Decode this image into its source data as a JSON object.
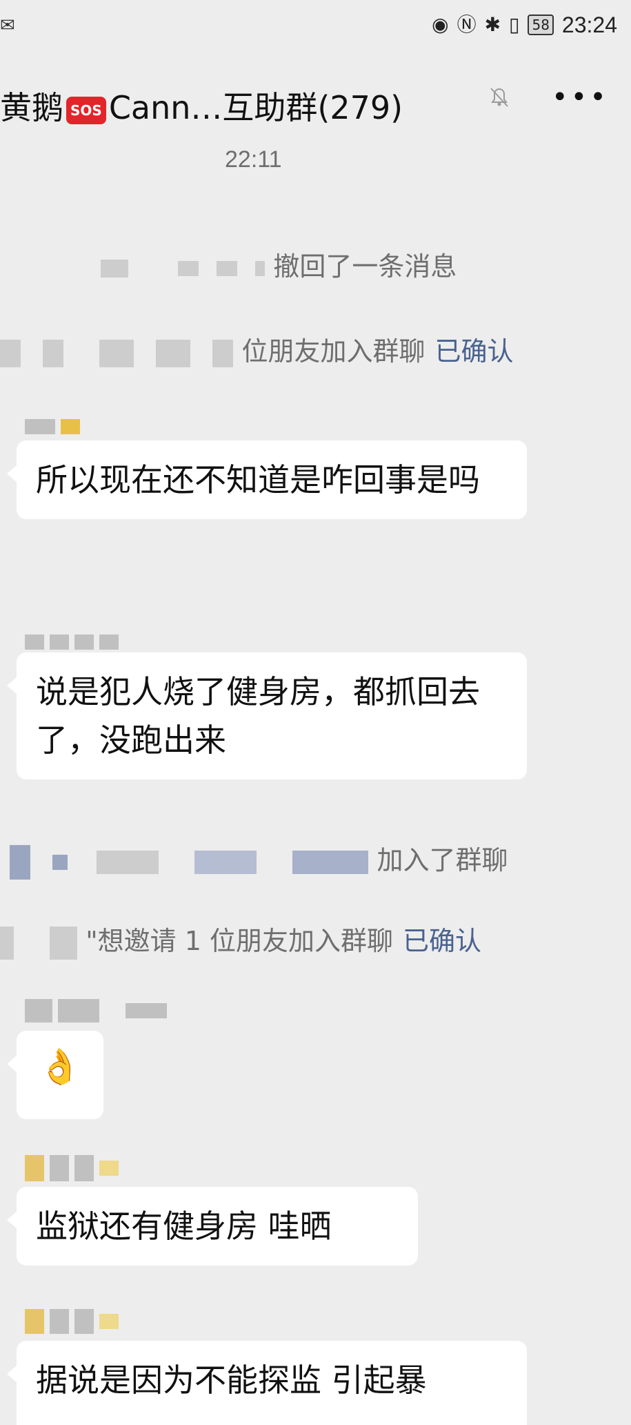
{
  "statusbar": {
    "time": "23:24",
    "battery": "58",
    "left_icon": "mail-icon",
    "icons": [
      "eye-icon",
      "nfc-icon",
      "bluetooth-icon",
      "vibrate-icon"
    ]
  },
  "header": {
    "title_prefix": "黄鹅",
    "sos": "SOS",
    "title_suffix": "Cann…互助群(279)",
    "muted_icon": "bell-muted-icon",
    "more_label": "•••"
  },
  "chat": {
    "timestamp": "22:11",
    "system_messages": [
      {
        "text": "撤回了一条消息",
        "confirm": ""
      },
      {
        "text": "位朋友加入群聊",
        "confirm": "已确认"
      },
      {
        "text": "加入了群聊",
        "confirm": ""
      },
      {
        "text": "\"想邀请 1 位朋友加入群聊",
        "confirm": "已确认"
      }
    ],
    "messages": [
      {
        "text": "所以现在还不知道是咋回事是吗"
      },
      {
        "text": "说是犯人烧了健身房，都抓回去了，没跑出来"
      },
      {
        "text": "👌"
      },
      {
        "text": "监狱还有健身房 哇晒"
      },
      {
        "text": "据说是因为不能探监 引起暴"
      }
    ]
  }
}
